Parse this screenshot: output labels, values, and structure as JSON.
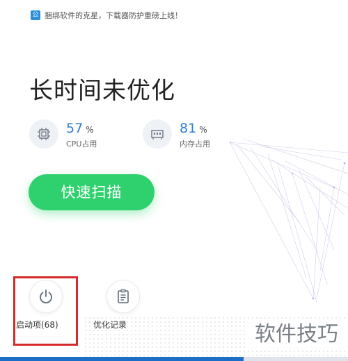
{
  "topbar": {
    "logo_char": "公",
    "notice": "捆绑软件的克星，下载器防护重磅上线！"
  },
  "headline": "长时间未优化",
  "stats": {
    "cpu": {
      "value": "57",
      "unit": "%",
      "label": "CPU占用",
      "icon": "cpu-chip-icon"
    },
    "mem": {
      "value": "81",
      "unit": "%",
      "label": "内存占用",
      "icon": "memory-icon"
    }
  },
  "scan_button": {
    "label": "快速扫描"
  },
  "tools": [
    {
      "label": "启动项(68)",
      "icon": "power-icon"
    },
    {
      "label": "优化记录",
      "icon": "clipboard-icon"
    }
  ],
  "watermark": "软件技巧",
  "colors": {
    "accent_blue": "#2a7fd0",
    "scan_green": "#2fd16e",
    "highlight_red": "#d62a2a"
  }
}
